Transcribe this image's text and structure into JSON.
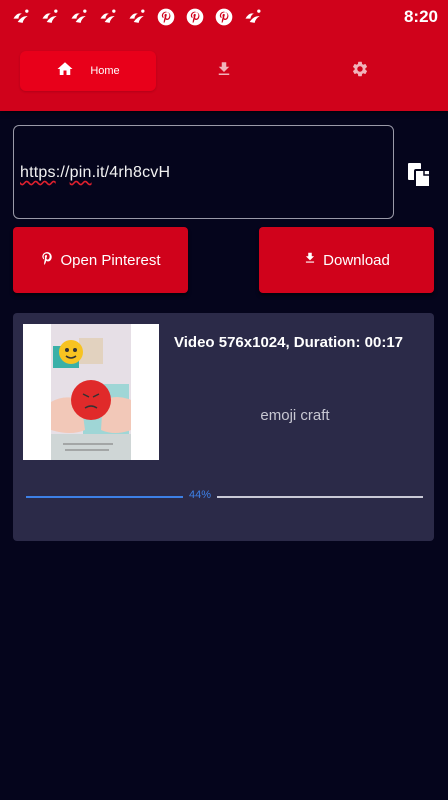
{
  "status_bar": {
    "time": "8:20",
    "notification_icons": [
      "app-notification-icon",
      "app-notification-icon",
      "app-notification-icon",
      "app-notification-icon",
      "app-notification-icon",
      "pinterest-icon",
      "pinterest-icon",
      "pinterest-icon",
      "app-notification-icon"
    ]
  },
  "nav": {
    "tabs": [
      {
        "label": "Home",
        "icon": "home-icon",
        "active": true
      },
      {
        "label": "",
        "icon": "download-icon",
        "active": false
      },
      {
        "label": "",
        "icon": "gear-icon",
        "active": false
      }
    ]
  },
  "url_input": {
    "value": "https://pin.it/4rh8cvH"
  },
  "buttons": {
    "open_pinterest": "Open Pinterest",
    "download": "Download"
  },
  "download_item": {
    "info": "Video 576x1024, Duration: 00:17",
    "title": "emoji craft",
    "progress": 0.44,
    "progress_label": "44%"
  },
  "colors": {
    "accent_red": "#d0021b",
    "background": "#05051c",
    "card": "#2b2a48",
    "progress_blue": "#3d80e6"
  }
}
